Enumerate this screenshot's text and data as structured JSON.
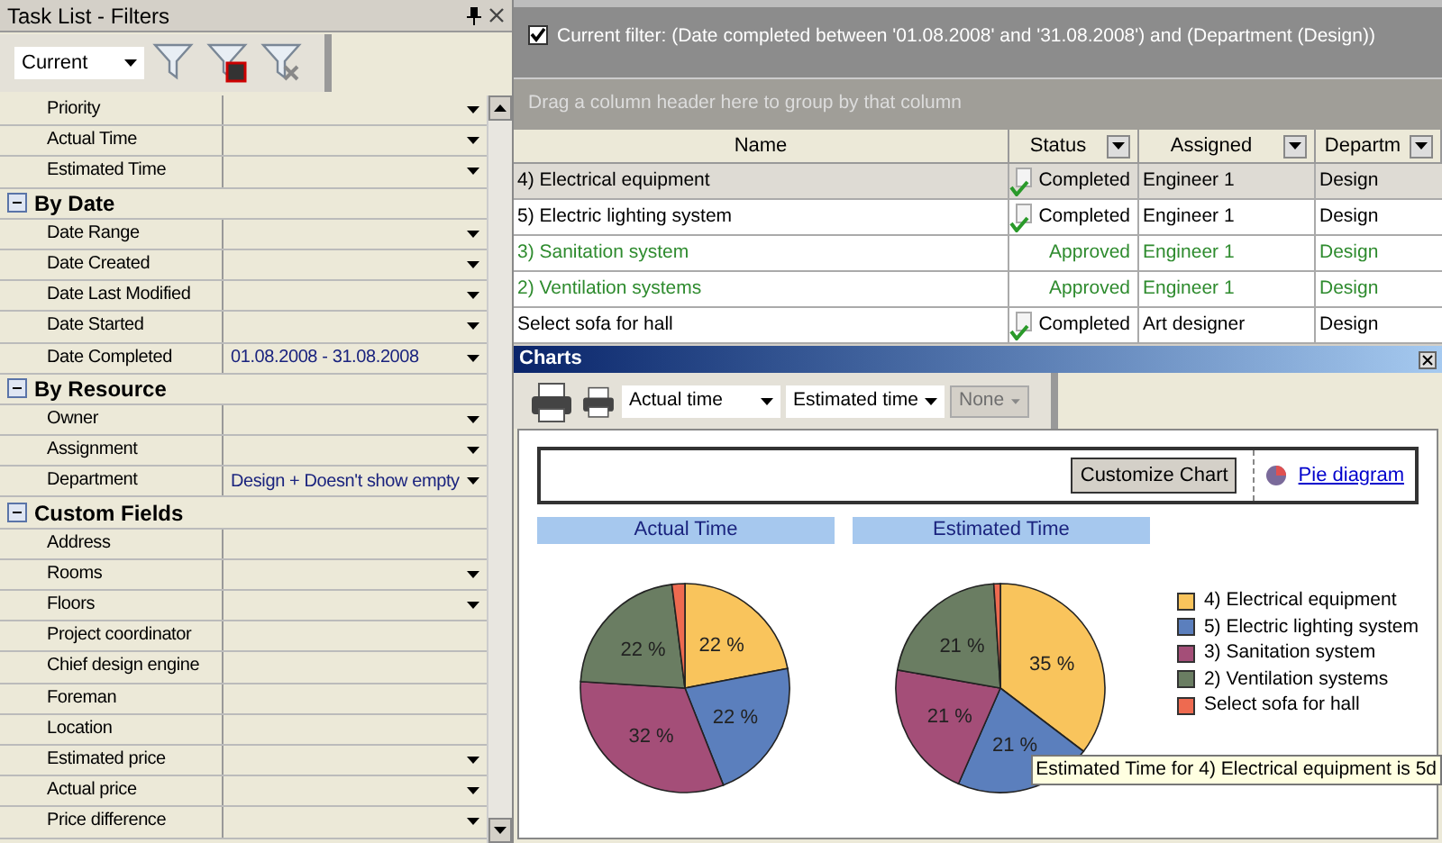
{
  "filters_panel": {
    "title": "Task List - Filters",
    "preset": "Current",
    "rows": [
      {
        "kind": "field",
        "label": "Priority",
        "value": "",
        "dropdown": true
      },
      {
        "kind": "field",
        "label": "Actual Time",
        "value": "",
        "dropdown": true
      },
      {
        "kind": "field",
        "label": "Estimated Time",
        "value": "",
        "dropdown": true
      },
      {
        "kind": "group",
        "label": "By Date",
        "expanded": true
      },
      {
        "kind": "field",
        "label": "Date Range",
        "value": "",
        "dropdown": true
      },
      {
        "kind": "field",
        "label": "Date Created",
        "value": "",
        "dropdown": true
      },
      {
        "kind": "field",
        "label": "Date Last Modified",
        "value": "",
        "dropdown": true
      },
      {
        "kind": "field",
        "label": "Date Started",
        "value": "",
        "dropdown": true
      },
      {
        "kind": "field",
        "label": "Date Completed",
        "value": "01.08.2008 - 31.08.2008",
        "dropdown": true
      },
      {
        "kind": "group",
        "label": "By Resource",
        "expanded": true
      },
      {
        "kind": "field",
        "label": "Owner",
        "value": "",
        "dropdown": true
      },
      {
        "kind": "field",
        "label": "Assignment",
        "value": "",
        "dropdown": true
      },
      {
        "kind": "field",
        "label": "Department",
        "value": "Design + Doesn't show empty",
        "dropdown": true
      },
      {
        "kind": "group",
        "label": "Custom Fields",
        "expanded": true
      },
      {
        "kind": "field",
        "label": "Address",
        "value": "",
        "dropdown": false
      },
      {
        "kind": "field",
        "label": "Rooms",
        "value": "",
        "dropdown": true
      },
      {
        "kind": "field",
        "label": "Floors",
        "value": "",
        "dropdown": true
      },
      {
        "kind": "field",
        "label": "Project coordinator",
        "value": "",
        "dropdown": false
      },
      {
        "kind": "field",
        "label": "Chief design engine",
        "value": "",
        "dropdown": false
      },
      {
        "kind": "field",
        "label": "Foreman",
        "value": "",
        "dropdown": false
      },
      {
        "kind": "field",
        "label": "Location",
        "value": "",
        "dropdown": false
      },
      {
        "kind": "field",
        "label": "Estimated price",
        "value": "",
        "dropdown": true
      },
      {
        "kind": "field",
        "label": "Actual price",
        "value": "",
        "dropdown": true
      },
      {
        "kind": "field",
        "label": "Price difference",
        "value": "",
        "dropdown": true
      }
    ]
  },
  "filter_bar": {
    "checked": true,
    "text": "Current filter:  (Date completed between '01.08.2008' and '31.08.2008') and (Department  (Design))"
  },
  "group_panel": {
    "placeholder": "Drag a column header here to group by that column"
  },
  "table": {
    "columns": [
      {
        "label": "Name",
        "filter": false
      },
      {
        "label": "Status",
        "filter": true
      },
      {
        "label": "Assigned",
        "filter": true
      },
      {
        "label": "Departm",
        "filter": true
      }
    ],
    "rows": [
      {
        "name": "4) Electrical equipment",
        "status": "Completed",
        "done": true,
        "assigned": "Engineer 1",
        "department": "Design",
        "color": "#000000",
        "selected": true
      },
      {
        "name": "5) Electric lighting system",
        "status": "Completed",
        "done": true,
        "assigned": "Engineer 1",
        "department": "Design",
        "color": "#000000",
        "selected": false
      },
      {
        "name": "3) Sanitation system",
        "status": "Approved",
        "done": false,
        "assigned": "Engineer 1",
        "department": "Design",
        "color": "#2e8b2e",
        "selected": false
      },
      {
        "name": "2) Ventilation systems",
        "status": "Approved",
        "done": false,
        "assigned": "Engineer 1",
        "department": "Design",
        "color": "#2e8b2e",
        "selected": false
      },
      {
        "name": "Select sofa for hall",
        "status": "Completed",
        "done": true,
        "assigned": "Art designer",
        "department": "Design",
        "color": "#000000",
        "selected": false
      }
    ]
  },
  "charts": {
    "title": "Charts",
    "combos": [
      {
        "value": "Actual time",
        "disabled": false
      },
      {
        "value": "Estimated time",
        "disabled": false
      },
      {
        "value": "None",
        "disabled": true
      }
    ],
    "customize_button": "Customize Chart",
    "pie_link": "Pie diagram",
    "pies": [
      {
        "chart_data": {
          "type": "pie",
          "title": "Actual Time",
          "values": [
            22,
            22,
            32,
            22,
            2
          ],
          "value_labels": [
            "22 %",
            "22 %",
            "32 %",
            "22 %",
            null
          ]
        }
      },
      {
        "chart_data": {
          "type": "pie",
          "title": "Estimated Time",
          "values": [
            35,
            21,
            21,
            21,
            1
          ],
          "value_labels": [
            "35 %",
            "21 %",
            "21 %",
            "21 %",
            null
          ]
        }
      }
    ],
    "legend": [
      {
        "label": "4) Electrical equipment",
        "color": "#f9c45c"
      },
      {
        "label": "5) Electric lighting system",
        "color": "#5b7fbd"
      },
      {
        "label": "3) Sanitation system",
        "color": "#a44e78"
      },
      {
        "label": "2) Ventilation systems",
        "color": "#6a7d62"
      },
      {
        "label": "Select sofa for hall",
        "color": "#ee6a50"
      }
    ],
    "tooltip": "Estimated Time for 4) Electrical equipment is 5d"
  }
}
